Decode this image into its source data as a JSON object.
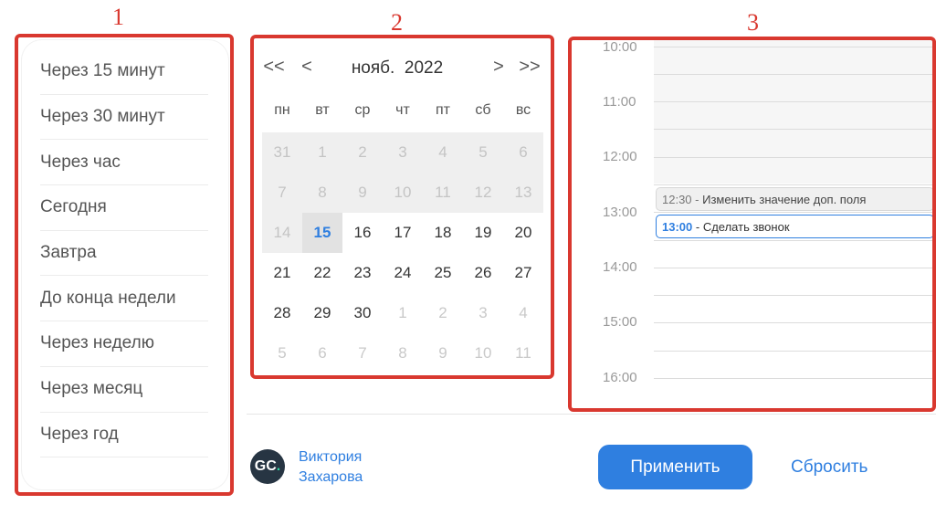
{
  "markers": {
    "one": "1",
    "two": "2",
    "three": "3"
  },
  "presets": [
    "Через 15 минут",
    "Через 30 минут",
    "Через час",
    "Сегодня",
    "Завтра",
    "До конца недели",
    "Через неделю",
    "Через месяц",
    "Через год"
  ],
  "calendar": {
    "nav_prev_year": "<<",
    "nav_prev_month": "<",
    "nav_next_month": ">",
    "nav_next_year": ">>",
    "month": "нояб.",
    "year": "2022",
    "weekdays": [
      "пн",
      "вт",
      "ср",
      "чт",
      "пт",
      "сб",
      "вс"
    ],
    "weeks": [
      [
        "31",
        "1",
        "2",
        "3",
        "4",
        "5",
        "6"
      ],
      [
        "7",
        "8",
        "9",
        "10",
        "11",
        "12",
        "13"
      ],
      [
        "14",
        "15",
        "16",
        "17",
        "18",
        "19",
        "20"
      ],
      [
        "21",
        "22",
        "23",
        "24",
        "25",
        "26",
        "27"
      ],
      [
        "28",
        "29",
        "30",
        "1",
        "2",
        "3",
        "4"
      ],
      [
        "5",
        "6",
        "7",
        "8",
        "9",
        "10",
        "11"
      ]
    ],
    "today": "15"
  },
  "timeline": {
    "hours": [
      "10:00",
      "11:00",
      "12:00",
      "13:00",
      "14:00",
      "15:00",
      "16:00"
    ],
    "events": [
      {
        "time": "12:30",
        "separator": " - ",
        "title": "Изменить значение доп. поля"
      },
      {
        "time": "13:00",
        "separator": " - ",
        "title": "Сделать звонок"
      }
    ]
  },
  "footer": {
    "avatar_initials": "GC",
    "avatar_dot": ".",
    "user_first": "Виктория",
    "user_last": "Захарова",
    "apply_label": "Применить",
    "reset_label": "Сбросить"
  },
  "colors": {
    "accent": "#2f7fe0",
    "highlight": "#d9382f"
  }
}
